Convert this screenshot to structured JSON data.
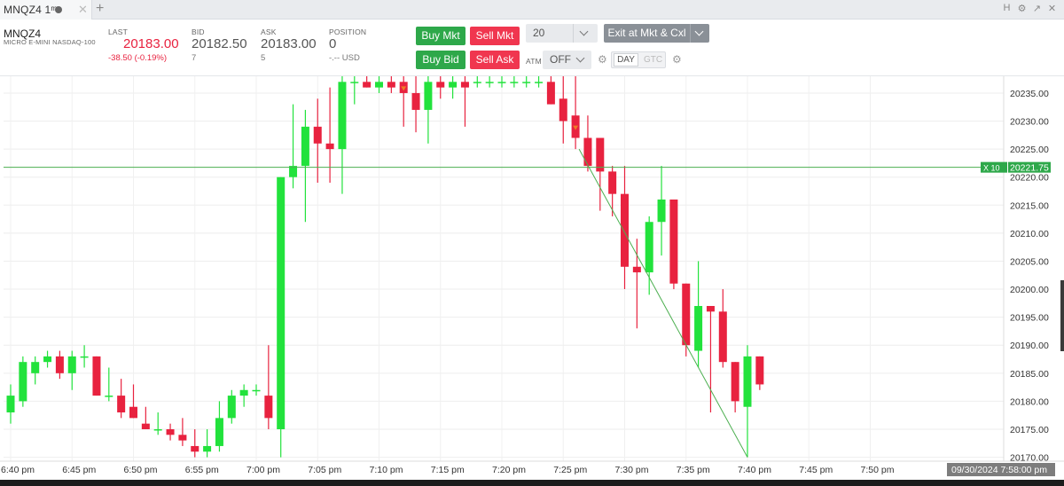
{
  "tab": {
    "label": "MNQZ4 1ᵐ"
  },
  "window_controls": [
    "H",
    "⚙",
    "↗",
    "✕"
  ],
  "instrument": {
    "symbol": "MNQZ4",
    "description": "MICRO E-MINI NASDAQ-100"
  },
  "quote": {
    "last_label": "LAST",
    "last": "20183.00",
    "change": "-38.50 (-0.19%)",
    "bid_label": "BID",
    "bid": "20182.50",
    "bid_size": "7",
    "ask_label": "ASK",
    "ask": "20183.00",
    "ask_size": "5",
    "position_label": "POSITION",
    "position": "0",
    "position_pnl": "-.-- USD"
  },
  "order_buttons": {
    "buy_mkt": "Buy Mkt",
    "sell_mkt": "Sell Mkt",
    "buy_bid": "Buy Bid",
    "sell_ask": "Sell Ask",
    "quantity": "20",
    "exit": "Exit at Mkt & Cxl",
    "atm_label": "ATM",
    "atm_value": "OFF",
    "tif_day": "DAY",
    "tif_gtc": "GTC"
  },
  "colors": {
    "up": "#22e23c",
    "down": "#e8223f",
    "order_line": "#4caf50",
    "trendline": "#4caf50",
    "buy_green": "#2ea84a",
    "sell_red": "#f0364f"
  },
  "chart_data": {
    "type": "candlestick",
    "interval": "1m",
    "ylim": [
      20170,
      20237.5
    ],
    "y_ticks": [
      "20235.00",
      "20230.00",
      "20225.00",
      "20220.00",
      "20215.00",
      "20210.00",
      "20205.00",
      "20200.00",
      "20195.00",
      "20190.00",
      "20185.00",
      "20180.00",
      "20175.00",
      "20170.00"
    ],
    "x_ticks": [
      "6:40 pm",
      "6:45 pm",
      "6:50 pm",
      "6:55 pm",
      "7:00 pm",
      "7:05 pm",
      "7:10 pm",
      "7:15 pm",
      "7:20 pm",
      "7:25 pm",
      "7:30 pm",
      "7:35 pm",
      "7:40 pm",
      "7:45 pm",
      "7:50 pm"
    ],
    "order_line": {
      "price": 20221.75,
      "label": "20221.75",
      "side": "X",
      "qty": "10"
    },
    "crosshair_time": "09/30/2024 7:58:00 pm",
    "trendline": [
      [
        20225,
        20170
      ]
    ],
    "candles": [
      {
        "o": 20178,
        "h": 20183,
        "l": 20176,
        "c": 20181
      },
      {
        "o": 20180,
        "h": 20188,
        "l": 20179,
        "c": 20187
      },
      {
        "o": 20185,
        "h": 20188,
        "l": 20183,
        "c": 20187
      },
      {
        "o": 20187,
        "h": 20189,
        "l": 20186,
        "c": 20188
      },
      {
        "o": 20188,
        "h": 20189,
        "l": 20184,
        "c": 20185
      },
      {
        "o": 20185,
        "h": 20189,
        "l": 20182,
        "c": 20188
      },
      {
        "o": 20188,
        "h": 20190,
        "l": 20186,
        "c": 20188
      },
      {
        "o": 20188,
        "h": 20188,
        "l": 20181,
        "c": 20181
      },
      {
        "o": 20181,
        "h": 20186,
        "l": 20180,
        "c": 20181
      },
      {
        "o": 20181,
        "h": 20184,
        "l": 20177,
        "c": 20178
      },
      {
        "o": 20179,
        "h": 20183,
        "l": 20177,
        "c": 20177
      },
      {
        "o": 20176,
        "h": 20179,
        "l": 20175,
        "c": 20175
      },
      {
        "o": 20175,
        "h": 20178,
        "l": 20174,
        "c": 20175
      },
      {
        "o": 20175,
        "h": 20176,
        "l": 20173,
        "c": 20174
      },
      {
        "o": 20174,
        "h": 20177,
        "l": 20172,
        "c": 20173
      },
      {
        "o": 20172,
        "h": 20175,
        "l": 20170,
        "c": 20171
      },
      {
        "o": 20171,
        "h": 20175,
        "l": 20170,
        "c": 20172
      },
      {
        "o": 20172,
        "h": 20180,
        "l": 20171,
        "c": 20177
      },
      {
        "o": 20177,
        "h": 20182,
        "l": 20176,
        "c": 20181
      },
      {
        "o": 20181,
        "h": 20183,
        "l": 20179,
        "c": 20182
      },
      {
        "o": 20182,
        "h": 20183,
        "l": 20181,
        "c": 20182
      },
      {
        "o": 20181,
        "h": 20190,
        "l": 20175,
        "c": 20177
      },
      {
        "o": 20175,
        "h": 20220,
        "l": 20170,
        "c": 20220
      },
      {
        "o": 20220,
        "h": 20233,
        "l": 20218,
        "c": 20222
      },
      {
        "o": 20222,
        "h": 20232,
        "l": 20212,
        "c": 20229
      },
      {
        "o": 20229,
        "h": 20234,
        "l": 20219,
        "c": 20226
      },
      {
        "o": 20226,
        "h": 20236,
        "l": 20219,
        "c": 20225
      },
      {
        "o": 20225,
        "h": 20238,
        "l": 20217,
        "c": 20237
      },
      {
        "o": 20237,
        "h": 20238,
        "l": 20233,
        "c": 20237
      },
      {
        "o": 20237,
        "h": 20238,
        "l": 20236,
        "c": 20236
      },
      {
        "o": 20236,
        "h": 20238,
        "l": 20235,
        "c": 20237
      },
      {
        "o": 20237,
        "h": 20238,
        "l": 20235,
        "c": 20236
      },
      {
        "o": 20237,
        "h": 20238,
        "l": 20229,
        "c": 20235
      },
      {
        "o": 20235,
        "h": 20238,
        "l": 20228,
        "c": 20232
      },
      {
        "o": 20232,
        "h": 20239,
        "l": 20226,
        "c": 20237
      },
      {
        "o": 20237,
        "h": 20238,
        "l": 20234,
        "c": 20236
      },
      {
        "o": 20236,
        "h": 20238,
        "l": 20234,
        "c": 20237
      },
      {
        "o": 20237,
        "h": 20238,
        "l": 20229,
        "c": 20236
      },
      {
        "o": 20237,
        "h": 20238,
        "l": 20236,
        "c": 20237
      },
      {
        "o": 20237,
        "h": 20238,
        "l": 20236,
        "c": 20237
      },
      {
        "o": 20237,
        "h": 20238,
        "l": 20236,
        "c": 20237
      },
      {
        "o": 20237,
        "h": 20238,
        "l": 20236,
        "c": 20237
      },
      {
        "o": 20237,
        "h": 20238,
        "l": 20236,
        "c": 20237
      },
      {
        "o": 20237,
        "h": 20238,
        "l": 20236,
        "c": 20237
      },
      {
        "o": 20237,
        "h": 20238,
        "l": 20233,
        "c": 20233
      },
      {
        "o": 20234,
        "h": 20238,
        "l": 20226,
        "c": 20230
      },
      {
        "o": 20231,
        "h": 20238,
        "l": 20225,
        "c": 20227
      },
      {
        "o": 20227,
        "h": 20231,
        "l": 20221,
        "c": 20222
      },
      {
        "o": 20227,
        "h": 20227,
        "l": 20214,
        "c": 20221
      },
      {
        "o": 20221,
        "h": 20222,
        "l": 20213,
        "c": 20217
      },
      {
        "o": 20217,
        "h": 20222,
        "l": 20200,
        "c": 20204
      },
      {
        "o": 20204,
        "h": 20209,
        "l": 20193,
        "c": 20203
      },
      {
        "o": 20203,
        "h": 20213,
        "l": 20199,
        "c": 20212
      },
      {
        "o": 20212,
        "h": 20222,
        "l": 20206,
        "c": 20216
      },
      {
        "o": 20216,
        "h": 20216,
        "l": 20200,
        "c": 20201
      },
      {
        "o": 20201,
        "h": 20201,
        "l": 20188,
        "c": 20190
      },
      {
        "o": 20189,
        "h": 20205,
        "l": 20186,
        "c": 20197
      },
      {
        "o": 20197,
        "h": 20197,
        "l": 20178,
        "c": 20196
      },
      {
        "o": 20196,
        "h": 20200,
        "l": 20186,
        "c": 20187
      },
      {
        "o": 20187,
        "h": 20187,
        "l": 20178,
        "c": 20180
      },
      {
        "o": 20179,
        "h": 20190,
        "l": 20170,
        "c": 20188
      },
      {
        "o": 20188,
        "h": 20188,
        "l": 20182,
        "c": 20183
      }
    ]
  }
}
